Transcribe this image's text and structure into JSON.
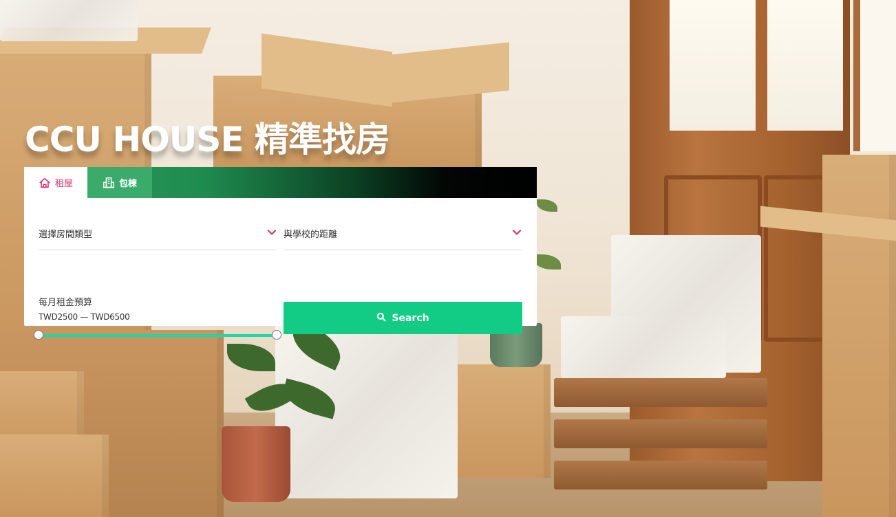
{
  "hero": {
    "title": "CCU HOUSE 精準找房"
  },
  "tabs": [
    {
      "label": "租屋",
      "icon": "house-icon",
      "active": true
    },
    {
      "label": "包棟",
      "icon": "building-icon",
      "active": false
    }
  ],
  "filters": {
    "room_type": {
      "label": "選擇房間類型",
      "icon": "chevron-down-icon"
    },
    "distance": {
      "label": "與學校的距離",
      "icon": "chevron-down-icon"
    }
  },
  "budget": {
    "label": "每月租金預算",
    "range_text": "TWD2500 — TWD6500",
    "min": 2500,
    "max": 6500,
    "selected_min": 2500,
    "selected_max": 6500
  },
  "search": {
    "label": "Search",
    "icon": "search-icon"
  },
  "colors": {
    "accent_pink": "#d6336c",
    "button_green": "#12cc86",
    "slider_green": "#20d6a5",
    "tab_green": "#3aab6a"
  }
}
